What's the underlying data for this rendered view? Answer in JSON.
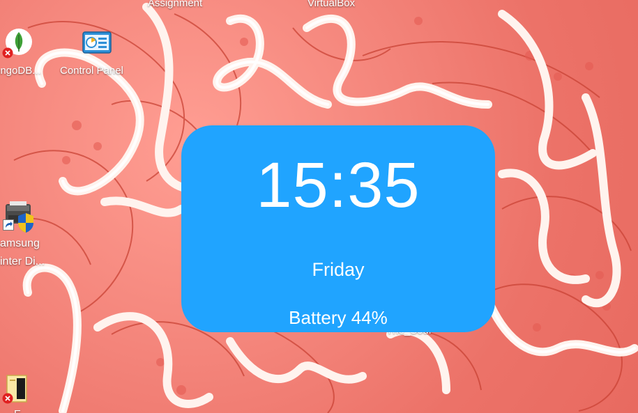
{
  "desktop": {
    "icons": [
      {
        "id": "assignment",
        "label": "Assignment"
      },
      {
        "id": "virtualbox",
        "label": "VirtualBox"
      },
      {
        "id": "mongodb",
        "label": "ongoDB..."
      },
      {
        "id": "control_panel",
        "label": "Control Panel"
      },
      {
        "id": "samsung",
        "label": "amsung",
        "label2": "inter Di..."
      },
      {
        "id": "the_soul",
        "label": "The_Soul"
      },
      {
        "id": "bottom_left",
        "label": "E..."
      }
    ]
  },
  "widget": {
    "time": "15:35",
    "day": "Friday",
    "battery": "Battery 44%",
    "background_color": "#20a4ff",
    "text_color": "#ffffff"
  }
}
